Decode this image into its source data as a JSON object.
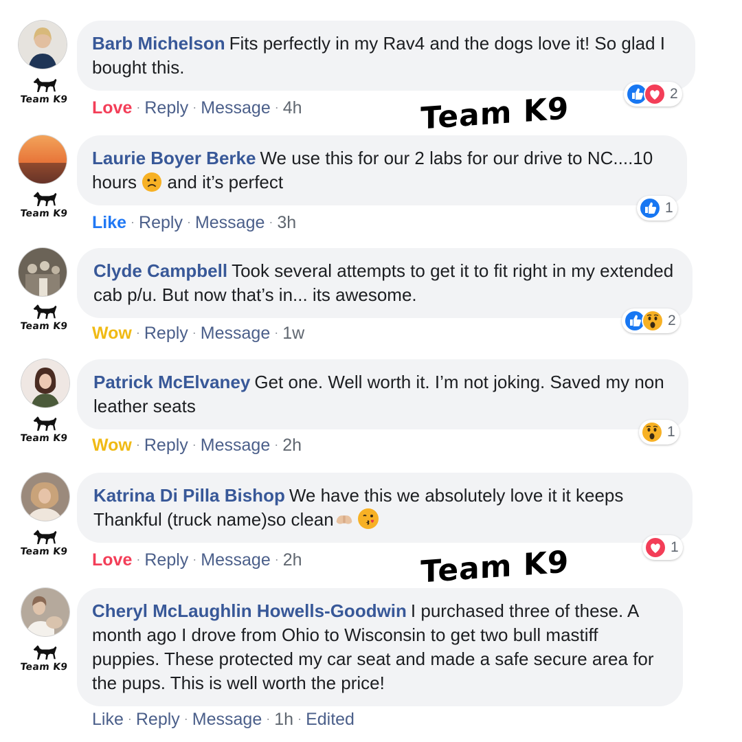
{
  "brand_label": "Team K9",
  "watermark_text": "Team K9",
  "colors": {
    "author": "#385898",
    "love": "#f33e58",
    "like": "#2078f4",
    "wow": "#f0ba15",
    "bubble": "#f2f3f5",
    "meta": "#606770"
  },
  "comments": [
    {
      "author": "Barb Michelson",
      "text": "Fits perfectly in my Rav4 and the dogs love it! So glad I bought this.",
      "reaction_label": "Love",
      "actions": [
        "Reply",
        "Message"
      ],
      "time": "4h",
      "reaction_icons": [
        "like-icon",
        "love-icon"
      ],
      "reaction_count": "2"
    },
    {
      "author": "Laurie Boyer Berke",
      "text_before": "We use this for our 2 labs for our drive to NC....10 hours ",
      "text_after": " and it’s perfect",
      "inline_emoji": "sad-face-emoji",
      "reaction_label": "Like",
      "actions": [
        "Reply",
        "Message"
      ],
      "time": "3h",
      "reaction_icons": [
        "like-icon"
      ],
      "reaction_count": "1"
    },
    {
      "author": "Clyde Campbell",
      "text": "Took several attempts to get it to fit right in my extended cab p/u. But now that’s in... its awesome.",
      "reaction_label": "Wow",
      "actions": [
        "Reply",
        "Message"
      ],
      "time": "1w",
      "reaction_icons": [
        "like-icon",
        "wow-icon"
      ],
      "reaction_count": "2"
    },
    {
      "author": "Patrick McElvaney",
      "text": "Get one. Well worth it. I’m not joking. Saved my non leather seats",
      "reaction_label": "Wow",
      "actions": [
        "Reply",
        "Message"
      ],
      "time": "2h",
      "reaction_icons": [
        "wow-icon"
      ],
      "reaction_count": "1"
    },
    {
      "author": "Katrina Di Pilla Bishop",
      "text": "We have this we absolutely love it it keeps Thankful (truck name)so clean",
      "inline_emojis": [
        "praying-hands-emoji",
        "kiss-face-emoji"
      ],
      "reaction_label": "Love",
      "actions": [
        "Reply",
        "Message"
      ],
      "time": "2h",
      "reaction_icons": [
        "love-icon"
      ],
      "reaction_count": "1"
    },
    {
      "author": "Cheryl McLaughlin Howells-Goodwin",
      "text": "I purchased three of these. A month ago I drove from Ohio to Wisconsin to get two bull mastiff puppies. These protected my car seat and made a safe secure area for the pups. This is well worth the price!",
      "reaction_label": "Like",
      "actions": [
        "Reply",
        "Message"
      ],
      "time": "1h",
      "edited_label": "Edited"
    }
  ]
}
